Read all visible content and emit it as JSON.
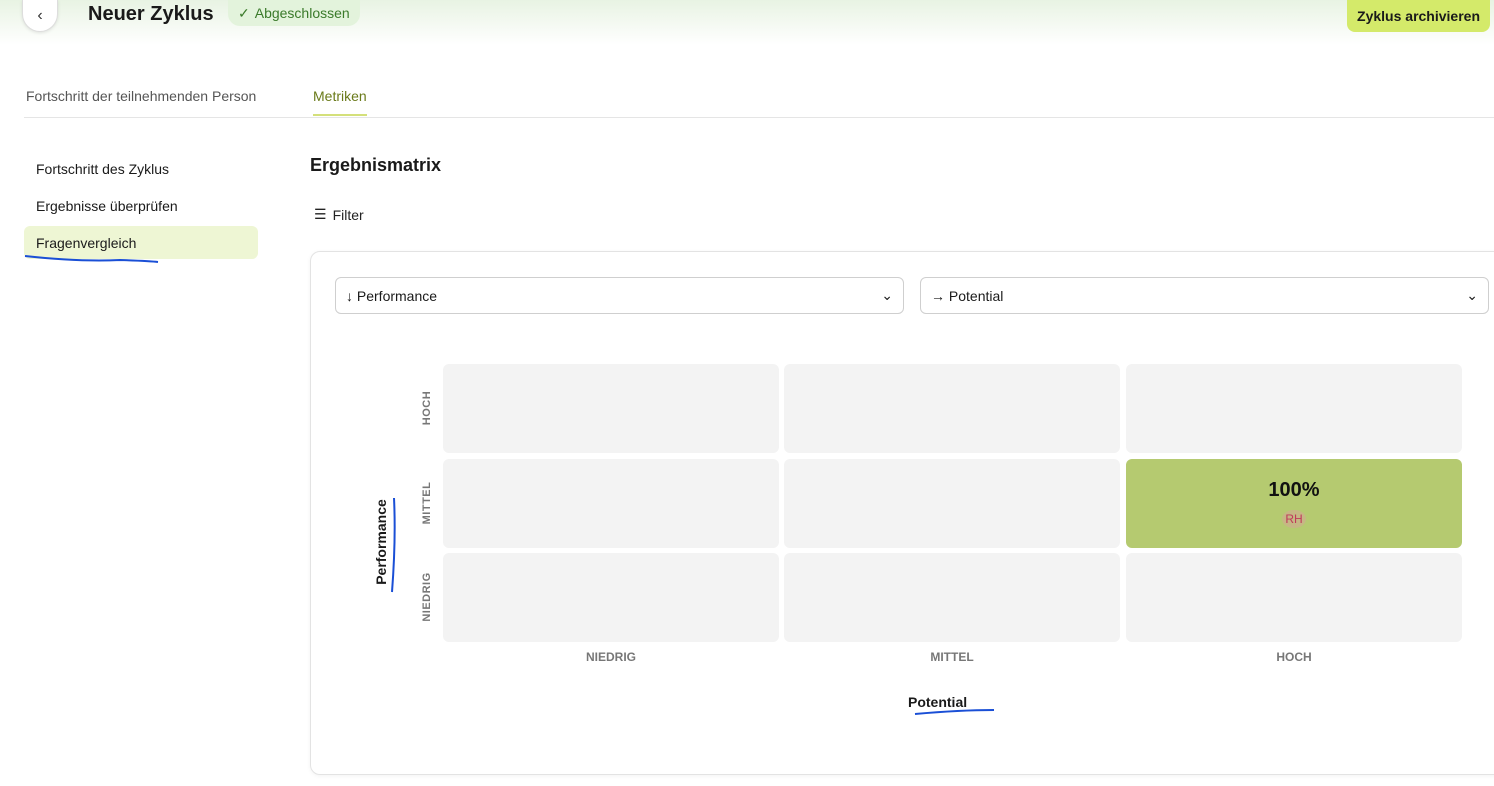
{
  "header": {
    "title": "Neuer Zyklus",
    "status": "Abgeschlossen",
    "archive_button": "Zyklus archivieren"
  },
  "tabs": [
    {
      "label": "Fortschritt der teilnehmenden Person"
    },
    {
      "label": "Metriken"
    }
  ],
  "sidebar": {
    "items": [
      {
        "label": "Fortschritt des Zyklus"
      },
      {
        "label": "Ergebnisse überprüfen"
      },
      {
        "label": "Fragenvergleich"
      }
    ]
  },
  "main": {
    "title": "Ergebnismatrix",
    "filter_label": "Filter",
    "y_select": "Performance",
    "x_select": "Potential",
    "y_axis_label": "Performance",
    "x_axis_label": "Potential",
    "y_levels": [
      "HOCH",
      "MITTEL",
      "NIEDRIG"
    ],
    "x_levels": [
      "NIEDRIG",
      "MITTEL",
      "HOCH"
    ],
    "highlight": {
      "percent": "100%",
      "initials": "RH"
    }
  },
  "colors": {
    "accent": "#d4ea6a",
    "highlight_cell": "#b5ca70",
    "annotation": "#1a4fd6"
  }
}
